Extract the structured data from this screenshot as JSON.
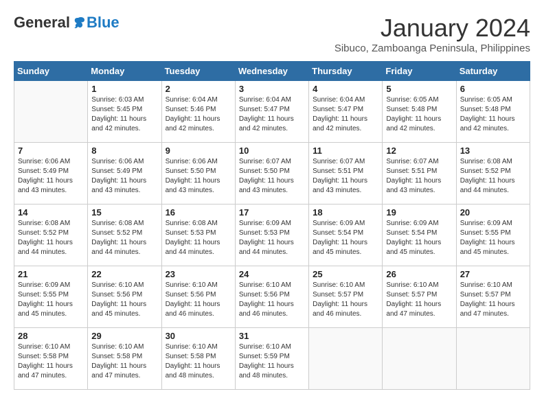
{
  "header": {
    "logo_general": "General",
    "logo_blue": "Blue",
    "month_title": "January 2024",
    "location": "Sibuco, Zamboanga Peninsula, Philippines"
  },
  "weekdays": [
    "Sunday",
    "Monday",
    "Tuesday",
    "Wednesday",
    "Thursday",
    "Friday",
    "Saturday"
  ],
  "weeks": [
    [
      {
        "day": "",
        "info": ""
      },
      {
        "day": "1",
        "info": "Sunrise: 6:03 AM\nSunset: 5:45 PM\nDaylight: 11 hours\nand 42 minutes."
      },
      {
        "day": "2",
        "info": "Sunrise: 6:04 AM\nSunset: 5:46 PM\nDaylight: 11 hours\nand 42 minutes."
      },
      {
        "day": "3",
        "info": "Sunrise: 6:04 AM\nSunset: 5:47 PM\nDaylight: 11 hours\nand 42 minutes."
      },
      {
        "day": "4",
        "info": "Sunrise: 6:04 AM\nSunset: 5:47 PM\nDaylight: 11 hours\nand 42 minutes."
      },
      {
        "day": "5",
        "info": "Sunrise: 6:05 AM\nSunset: 5:48 PM\nDaylight: 11 hours\nand 42 minutes."
      },
      {
        "day": "6",
        "info": "Sunrise: 6:05 AM\nSunset: 5:48 PM\nDaylight: 11 hours\nand 42 minutes."
      }
    ],
    [
      {
        "day": "7",
        "info": "Sunrise: 6:06 AM\nSunset: 5:49 PM\nDaylight: 11 hours\nand 43 minutes."
      },
      {
        "day": "8",
        "info": "Sunrise: 6:06 AM\nSunset: 5:49 PM\nDaylight: 11 hours\nand 43 minutes."
      },
      {
        "day": "9",
        "info": "Sunrise: 6:06 AM\nSunset: 5:50 PM\nDaylight: 11 hours\nand 43 minutes."
      },
      {
        "day": "10",
        "info": "Sunrise: 6:07 AM\nSunset: 5:50 PM\nDaylight: 11 hours\nand 43 minutes."
      },
      {
        "day": "11",
        "info": "Sunrise: 6:07 AM\nSunset: 5:51 PM\nDaylight: 11 hours\nand 43 minutes."
      },
      {
        "day": "12",
        "info": "Sunrise: 6:07 AM\nSunset: 5:51 PM\nDaylight: 11 hours\nand 43 minutes."
      },
      {
        "day": "13",
        "info": "Sunrise: 6:08 AM\nSunset: 5:52 PM\nDaylight: 11 hours\nand 44 minutes."
      }
    ],
    [
      {
        "day": "14",
        "info": "Sunrise: 6:08 AM\nSunset: 5:52 PM\nDaylight: 11 hours\nand 44 minutes."
      },
      {
        "day": "15",
        "info": "Sunrise: 6:08 AM\nSunset: 5:52 PM\nDaylight: 11 hours\nand 44 minutes."
      },
      {
        "day": "16",
        "info": "Sunrise: 6:08 AM\nSunset: 5:53 PM\nDaylight: 11 hours\nand 44 minutes."
      },
      {
        "day": "17",
        "info": "Sunrise: 6:09 AM\nSunset: 5:53 PM\nDaylight: 11 hours\nand 44 minutes."
      },
      {
        "day": "18",
        "info": "Sunrise: 6:09 AM\nSunset: 5:54 PM\nDaylight: 11 hours\nand 45 minutes."
      },
      {
        "day": "19",
        "info": "Sunrise: 6:09 AM\nSunset: 5:54 PM\nDaylight: 11 hours\nand 45 minutes."
      },
      {
        "day": "20",
        "info": "Sunrise: 6:09 AM\nSunset: 5:55 PM\nDaylight: 11 hours\nand 45 minutes."
      }
    ],
    [
      {
        "day": "21",
        "info": "Sunrise: 6:09 AM\nSunset: 5:55 PM\nDaylight: 11 hours\nand 45 minutes."
      },
      {
        "day": "22",
        "info": "Sunrise: 6:10 AM\nSunset: 5:56 PM\nDaylight: 11 hours\nand 45 minutes."
      },
      {
        "day": "23",
        "info": "Sunrise: 6:10 AM\nSunset: 5:56 PM\nDaylight: 11 hours\nand 46 minutes."
      },
      {
        "day": "24",
        "info": "Sunrise: 6:10 AM\nSunset: 5:56 PM\nDaylight: 11 hours\nand 46 minutes."
      },
      {
        "day": "25",
        "info": "Sunrise: 6:10 AM\nSunset: 5:57 PM\nDaylight: 11 hours\nand 46 minutes."
      },
      {
        "day": "26",
        "info": "Sunrise: 6:10 AM\nSunset: 5:57 PM\nDaylight: 11 hours\nand 47 minutes."
      },
      {
        "day": "27",
        "info": "Sunrise: 6:10 AM\nSunset: 5:57 PM\nDaylight: 11 hours\nand 47 minutes."
      }
    ],
    [
      {
        "day": "28",
        "info": "Sunrise: 6:10 AM\nSunset: 5:58 PM\nDaylight: 11 hours\nand 47 minutes."
      },
      {
        "day": "29",
        "info": "Sunrise: 6:10 AM\nSunset: 5:58 PM\nDaylight: 11 hours\nand 47 minutes."
      },
      {
        "day": "30",
        "info": "Sunrise: 6:10 AM\nSunset: 5:58 PM\nDaylight: 11 hours\nand 48 minutes."
      },
      {
        "day": "31",
        "info": "Sunrise: 6:10 AM\nSunset: 5:59 PM\nDaylight: 11 hours\nand 48 minutes."
      },
      {
        "day": "",
        "info": ""
      },
      {
        "day": "",
        "info": ""
      },
      {
        "day": "",
        "info": ""
      }
    ]
  ]
}
